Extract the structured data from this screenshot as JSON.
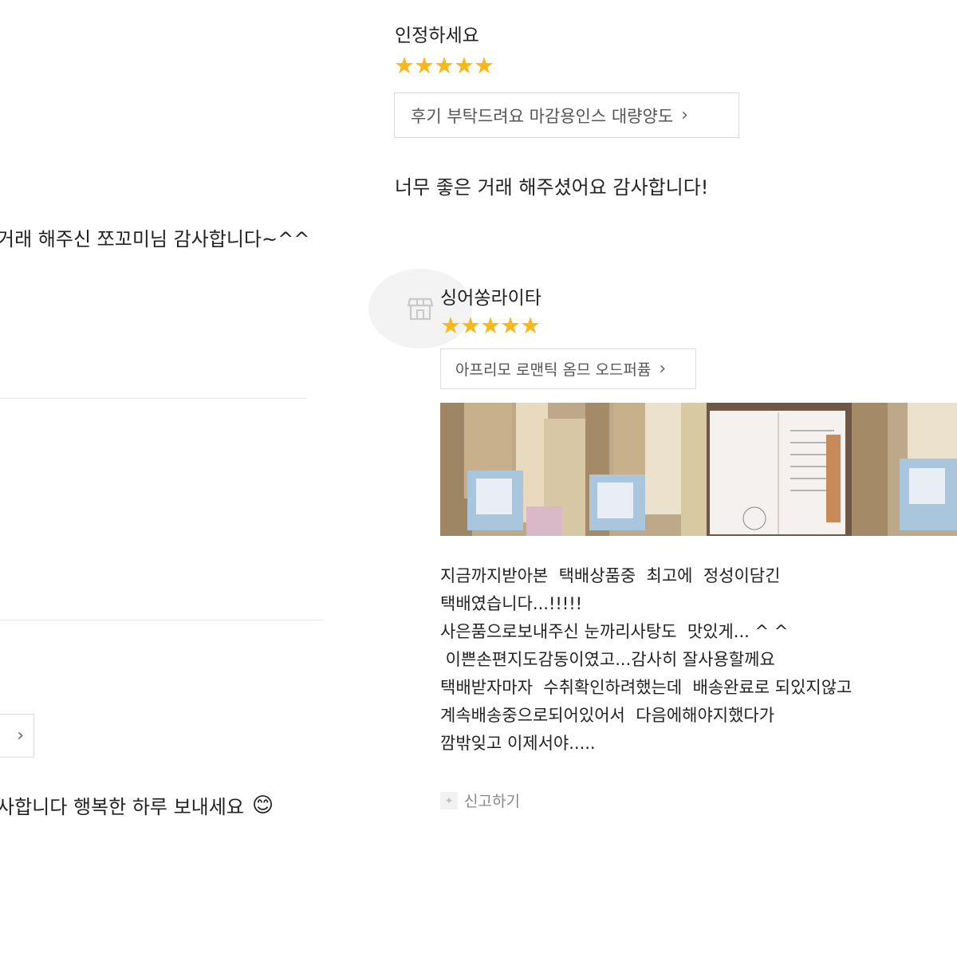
{
  "reviews_left": {
    "comment_1": "거래 해주신 쪼꼬미님 감사합니다~^^",
    "comment_2": "사합니다 행복한 하루 보내세요",
    "emoji": "😊",
    "chevron": "›"
  },
  "review_1": {
    "name": "인정하세요",
    "stars": "★★★★★",
    "product": "후기 부탁드려요 마감용인스 대량양도",
    "chevron": "›",
    "comment": "너무 좋은 거래 해주셨어요 감사합니다!"
  },
  "review_2": {
    "name": "싱어쏭라이타",
    "stars": "★★★★★",
    "product": "아프리모 로맨틱 옴므 오드퍼퓸",
    "chevron": "›",
    "body": "지금까지받아본  택배상품중  최고에  정성이담긴\n택배였습니다...!!!!!\n사은품으로보내주신 눈까리사탕도  맛있게... ^ ^\n 이쁜손편지도감동이였고...감사히 잘사용할께요\n택배받자마자  수취확인하려했는데  배송완료로 되있지않고\n계속배송중으로되어있어서  다음에해야지했다가\n깜밖잊고 이제서야.....",
    "report_label": "신고하기",
    "icon_avatar": "store-icon",
    "icon_report": "siren-icon"
  },
  "colors": {
    "star": "#f7b81c",
    "text": "#222222",
    "muted": "#888888",
    "border": "#dcdcdc"
  }
}
